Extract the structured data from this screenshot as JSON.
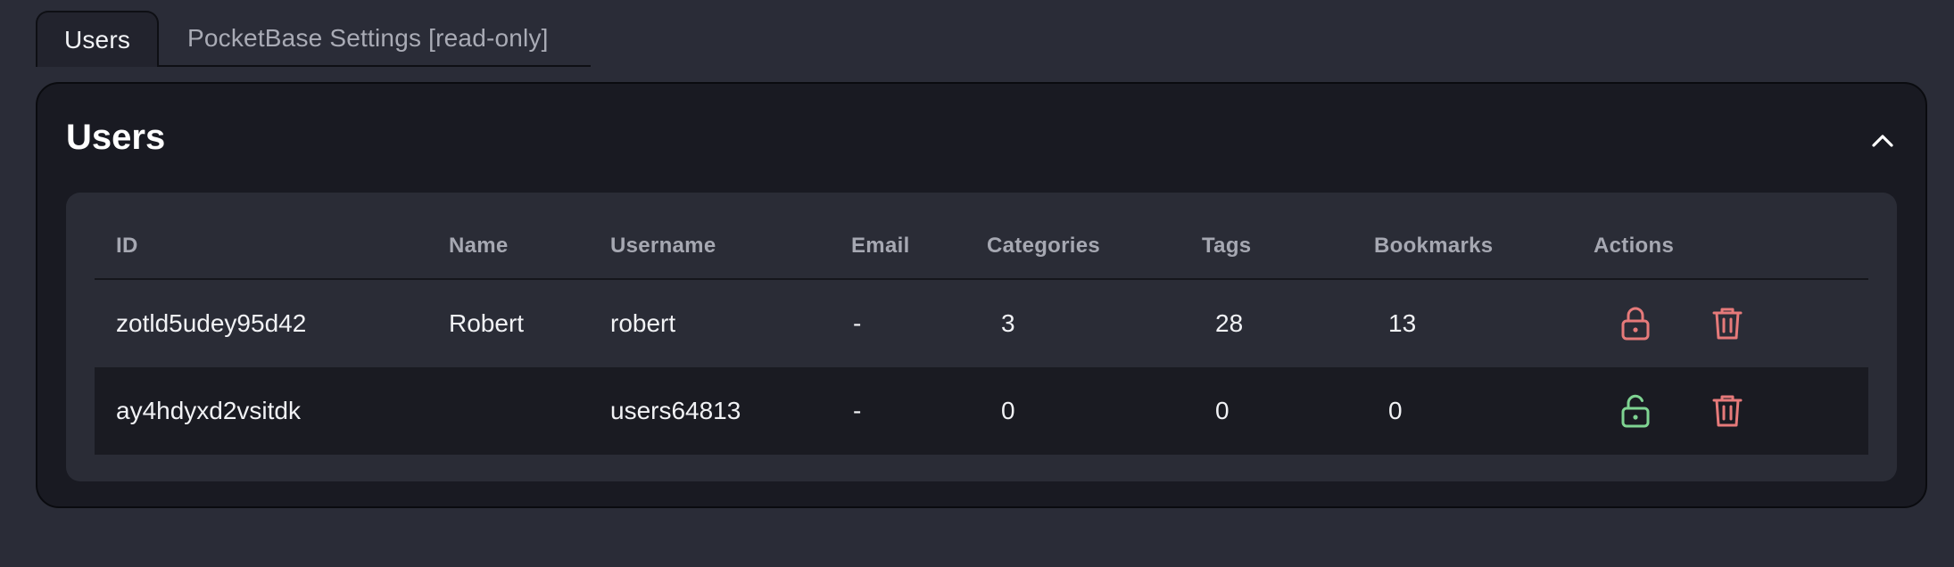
{
  "tabs": [
    {
      "label": "Users",
      "active": true
    },
    {
      "label": "PocketBase Settings [read-only]",
      "active": false
    }
  ],
  "panel": {
    "title": "Users",
    "collapse_icon": "chevron-up-icon"
  },
  "table": {
    "columns": [
      "ID",
      "Name",
      "Username",
      "Email",
      "Categories",
      "Tags",
      "Bookmarks",
      "Actions"
    ],
    "rows": [
      {
        "id": "zotld5udey95d42",
        "name": "Robert",
        "username": "robert",
        "email": "-",
        "categories": "3",
        "tags": "28",
        "bookmarks": "13",
        "lock_icon": "lock-closed-icon",
        "delete_icon": "trash-icon"
      },
      {
        "id": "ay4hdyxd2vsitdk",
        "name": "",
        "username": "users64813",
        "email": "-",
        "categories": "0",
        "tags": "0",
        "bookmarks": "0",
        "lock_icon": "lock-open-icon",
        "delete_icon": "trash-icon"
      }
    ]
  },
  "colors": {
    "page_bg": "#2a2c37",
    "panel_bg": "#191a22",
    "inner_bg": "#2a2c36",
    "lock_closed": "#e67a7a",
    "lock_open": "#7fd492",
    "delete": "#e67a7a"
  }
}
